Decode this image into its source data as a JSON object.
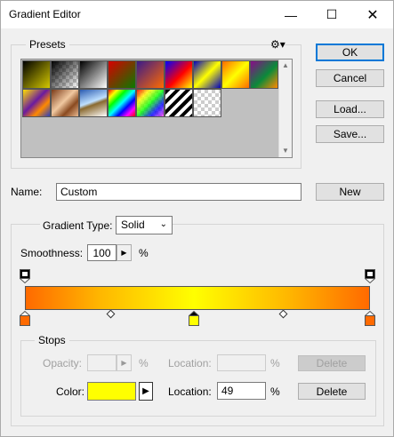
{
  "window": {
    "title": "Gradient Editor"
  },
  "presets": {
    "legend": "Presets",
    "swatches": [
      {
        "name": "foreground-to-background",
        "css": "linear-gradient(135deg,#000 0%,#d4c800 100%)"
      },
      {
        "name": "foreground-to-transparent",
        "css": "linear-gradient(135deg,#000 0%,rgba(0,0,0,0) 100%)"
      },
      {
        "name": "black-white",
        "css": "linear-gradient(135deg,#000 0%,#fff 100%)"
      },
      {
        "name": "red-green",
        "css": "linear-gradient(135deg,#d80000 0%,#0a7a00 100%)"
      },
      {
        "name": "violet-orange",
        "css": "linear-gradient(135deg,#3a1a8a 0%,#ff6a00 100%)"
      },
      {
        "name": "blue-red-yellow",
        "css": "linear-gradient(135deg,#0000ff 0%,#ff0000 55%,#ffff00 100%)"
      },
      {
        "name": "blue-yellow-blue",
        "css": "linear-gradient(135deg,#0000c0 0%,#ffff00 50%,#0000c0 100%)"
      },
      {
        "name": "orange-yellow-orange",
        "css": "linear-gradient(135deg,#ff6a00 0%,#ffff00 50%,#ff6a00 100%)"
      },
      {
        "name": "violet-green-orange",
        "css": "linear-gradient(135deg,#8a0a8a 0%,#0a8a3a 55%,#ff8a00 100%)"
      },
      {
        "name": "yellow-violet-orange-blue",
        "css": "linear-gradient(135deg,#ffe000 0%,#6a1aa0 45%,#ff8a00 70%,#2a40c0 100%)"
      },
      {
        "name": "copper",
        "css": "linear-gradient(135deg,#7a3a18 0%,#f0c8a0 45%,#8a4a20 70%,#e8b890 100%)"
      },
      {
        "name": "chrome",
        "css": "linear-gradient(160deg,#2a5ab0 0%,#bfe0ff 45%,#8a6a30 55%,#fff 100%)"
      },
      {
        "name": "spectrum",
        "css": "linear-gradient(135deg,#ff0000,#ffff00,#00ff00,#00ffff,#0000ff,#ff00ff,#ff0000)"
      },
      {
        "name": "transparent-rainbow",
        "css": "linear-gradient(135deg,rgba(255,0,0,.9),rgba(255,255,0,.8),rgba(0,255,0,.8),rgba(0,0,255,.8),rgba(255,0,255,.6))"
      },
      {
        "name": "transparent-stripes",
        "css": "repeating-linear-gradient(135deg,#000 0 4px,#fff 4px 8px)"
      },
      {
        "name": "transparent",
        "css": "none"
      }
    ]
  },
  "buttons": {
    "ok": "OK",
    "cancel": "Cancel",
    "load": "Load...",
    "save": "Save...",
    "new": "New"
  },
  "name_field": {
    "label": "Name:",
    "value": "Custom"
  },
  "gradient_type": {
    "label": "Gradient Type:",
    "value": "Solid"
  },
  "smoothness": {
    "label": "Smoothness:",
    "value": "100",
    "unit": "%"
  },
  "stops": {
    "legend": "Stops",
    "opacity_label": "Opacity:",
    "opacity_value": "",
    "opacity_unit": "%",
    "opacity_location_label": "Location:",
    "opacity_location_value": "",
    "opacity_location_unit": "%",
    "opacity_delete": "Delete",
    "color_label": "Color:",
    "color_value": "#ffff00",
    "color_location_label": "Location:",
    "color_location_value": "49",
    "color_location_unit": "%",
    "color_delete": "Delete"
  },
  "gradient": {
    "color_stops": [
      {
        "location": 0,
        "color": "#ff6a00"
      },
      {
        "location": 49,
        "color": "#ffff00",
        "selected": true
      },
      {
        "location": 100,
        "color": "#ff6a00"
      }
    ],
    "opacity_stops": [
      {
        "location": 0,
        "opacity": 100
      },
      {
        "location": 100,
        "opacity": 100
      }
    ],
    "midpoints": [
      25,
      75
    ]
  }
}
